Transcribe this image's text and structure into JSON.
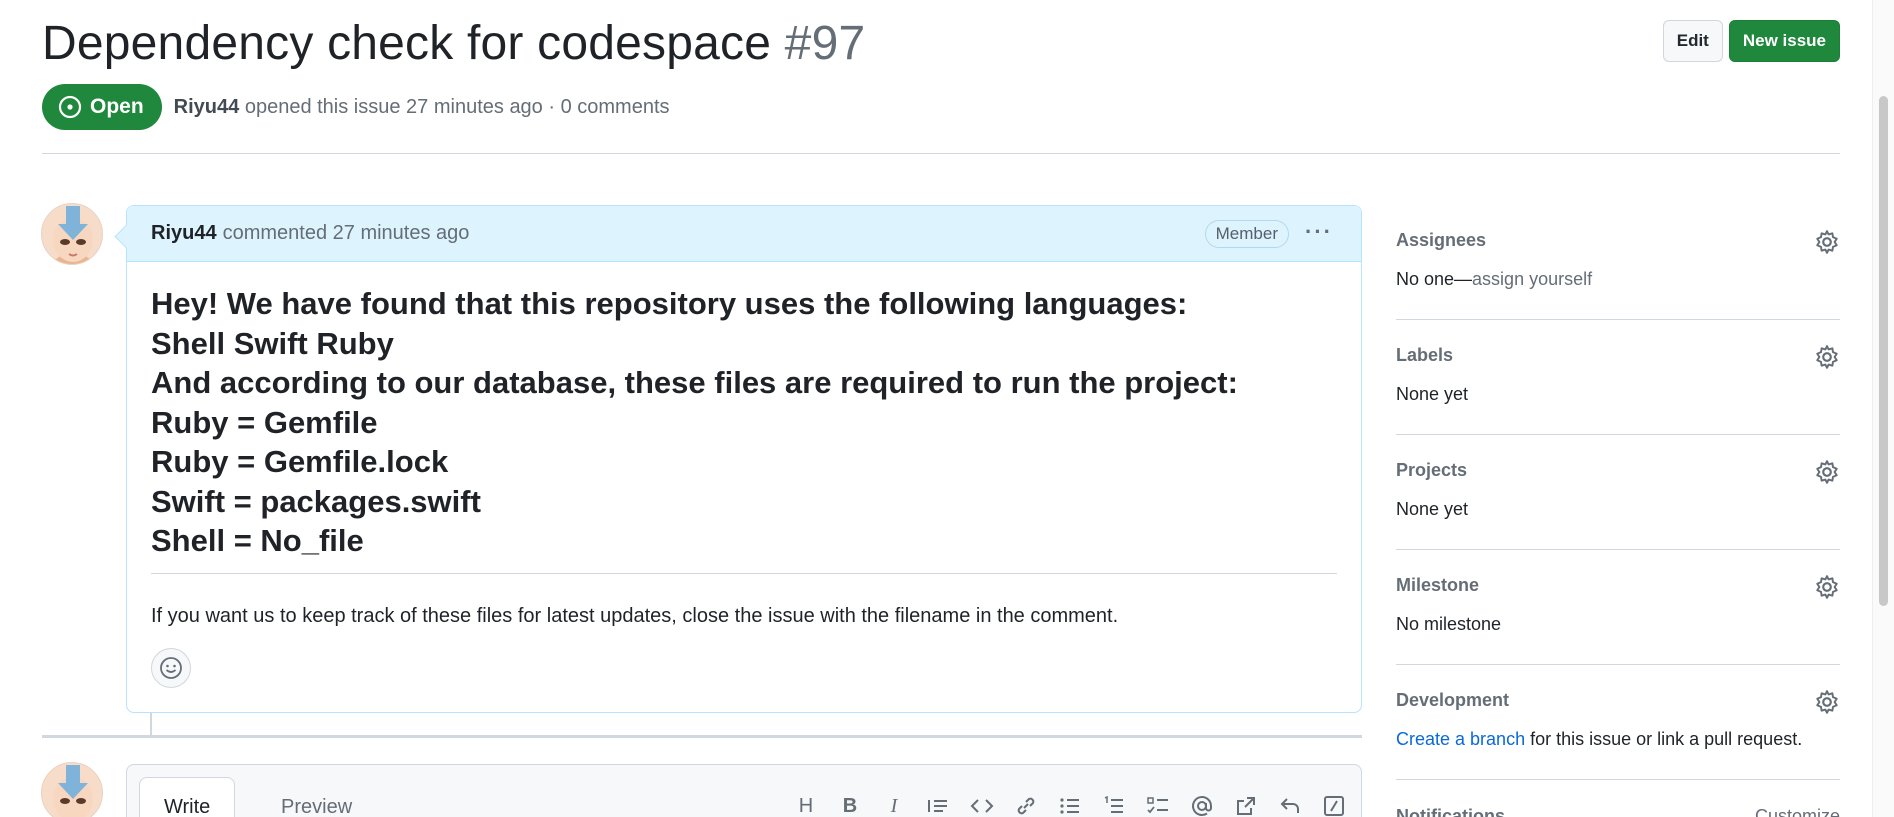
{
  "issue": {
    "title": "Dependency check for codespace",
    "number": "#97",
    "state": "Open",
    "author": "Riyu44",
    "meta": "opened this issue 27 minutes ago · 0 comments"
  },
  "header_actions": {
    "edit": "Edit",
    "new_issue": "New issue"
  },
  "comment": {
    "author": "Riyu44",
    "time": "commented 27 minutes ago",
    "badge": "Member",
    "lines": [
      "Hey! We have found that this repository uses the following languages:",
      "Shell Swift Ruby",
      "And according to our database, these files are required to run the project:",
      "Ruby = Gemfile",
      "Ruby = Gemfile.lock",
      "Swift = packages.swift",
      "Shell = No_file"
    ],
    "note": "If you want us to keep track of these files for latest updates, close the issue with the filename in the comment."
  },
  "composer": {
    "tabs": [
      "Write",
      "Preview"
    ],
    "toolbar_icons": [
      "heading-icon",
      "bold-icon",
      "italic-icon",
      "quote-icon",
      "code-icon",
      "link-icon",
      "bulleted-list-icon",
      "numbered-list-icon",
      "task-list-icon",
      "mention-icon",
      "cross-reference-icon",
      "saved-reply-icon",
      "slash-command-icon"
    ]
  },
  "sidebar": {
    "assignees": {
      "title": "Assignees",
      "value": "No one—",
      "action": "assign yourself"
    },
    "labels": {
      "title": "Labels",
      "value": "None yet"
    },
    "projects": {
      "title": "Projects",
      "value": "None yet"
    },
    "milestone": {
      "title": "Milestone",
      "value": "No milestone"
    },
    "development": {
      "title": "Development",
      "link": "Create a branch",
      "value": " for this issue or link a pull request."
    },
    "notifications": {
      "title": "Notifications",
      "action": "Customize"
    }
  },
  "colors": {
    "open_green": "#1f883d",
    "link_blue": "#0969da",
    "comment_header": "#ddf4ff"
  }
}
